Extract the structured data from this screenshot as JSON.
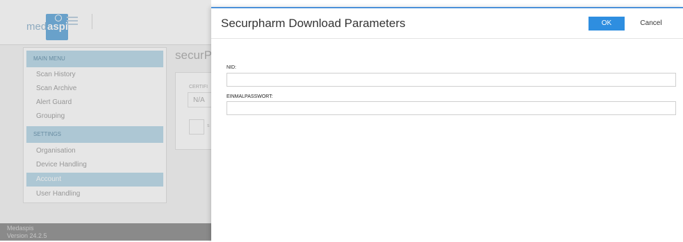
{
  "app": {
    "logo": {
      "text_left": "med",
      "text_right": "aspis"
    },
    "footer": {
      "name": "Medaspis",
      "version": "Version 24.2.5"
    }
  },
  "sidebar": {
    "main_menu_header": "MAIN MENU",
    "main_items": [
      {
        "label": "Scan History"
      },
      {
        "label": "Scan Archive"
      },
      {
        "label": "Alert Guard"
      },
      {
        "label": "Grouping"
      }
    ],
    "settings_header": "SETTINGS",
    "settings_items": [
      {
        "label": "Organisation"
      },
      {
        "label": "Device Handling"
      },
      {
        "label": "Account",
        "active": true
      },
      {
        "label": "User Handling"
      }
    ]
  },
  "main": {
    "title": "securP",
    "cert_label": "CERTIFI",
    "cert_value": "N/A",
    "check_label": "s"
  },
  "dialog": {
    "title": "Securpharm Download Parameters",
    "ok_label": "OK",
    "cancel_label": "Cancel",
    "fields": [
      {
        "label": "NID:",
        "value": ""
      },
      {
        "label": "EINMALPASSWORT:",
        "value": ""
      }
    ]
  },
  "colors": {
    "accent": "#2e8ee0",
    "menu_highlight": "#b7d8e8",
    "footer": "#8a8a8a"
  }
}
